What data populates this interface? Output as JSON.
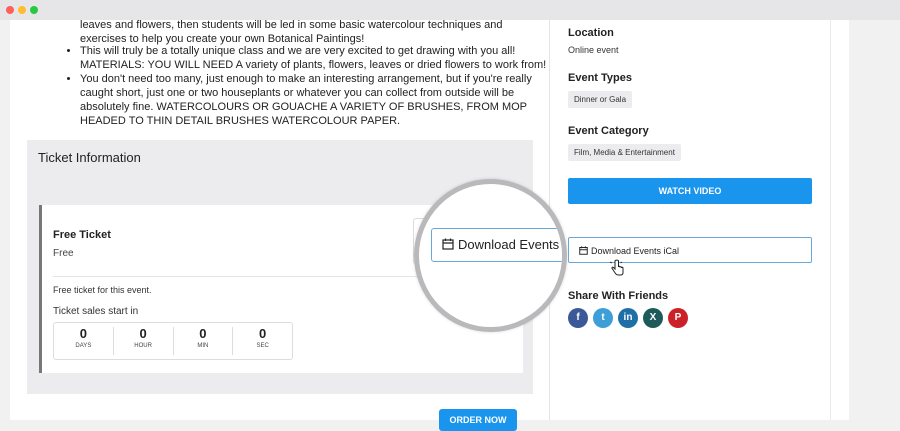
{
  "description": {
    "lead": "leaves and flowers, then students will be led in some basic watercolour techniques and exercises to help you create your own Botanical Paintings!",
    "bullets": [
      "This will truly be a totally unique class and we are very excited to get drawing with you all!   MATERIALS: YOU WILL NEED A variety of plants, flowers, leaves or dried flowers to work from!",
      "You don't need too many, just enough to make an interesting arrangement, but if you're really caught short, just one or two houseplants or whatever you can collect from outside will be absolutely fine. WATERCOLOURS OR GOUACHE A VARIETY OF BRUSHES, FROM MOP HEADED TO THIN DETAIL BRUSHES WATERCOLOUR PAPER."
    ]
  },
  "ticket": {
    "section_title": "Ticket Information",
    "name": "Free Ticket",
    "price": "Free",
    "note": "Free ticket for this event.",
    "sales_label": "Ticket sales start in",
    "countdown": [
      {
        "value": "0",
        "label": "DAYS"
      },
      {
        "value": "0",
        "label": "HOUR"
      },
      {
        "value": "0",
        "label": "MIN"
      },
      {
        "value": "0",
        "label": "SEC"
      }
    ],
    "order_label": "ORDER NOW"
  },
  "magnifier": {
    "button_label": "Download Events iCal"
  },
  "sidebar": {
    "location_title": "Location",
    "location_value": "Online event",
    "types_title": "Event Types",
    "types_tag": "Dinner or Gala",
    "category_title": "Event Category",
    "category_tag": "Film, Media & Entertainment",
    "watch_label": "WATCH VIDEO",
    "ical_label": "Download Events iCal",
    "share_title": "Share With Friends",
    "share": [
      {
        "icon": "facebook-icon",
        "glyph": "f"
      },
      {
        "icon": "twitter-icon",
        "glyph": "t"
      },
      {
        "icon": "linkedin-icon",
        "glyph": "in"
      },
      {
        "icon": "xing-icon",
        "glyph": "X"
      },
      {
        "icon": "pinterest-icon",
        "glyph": "P"
      }
    ]
  },
  "colors": {
    "accent": "#1a95ee",
    "facebook": "#3b5998",
    "twitter": "#3e9fd8",
    "linkedin": "#1f6fa7",
    "xing": "#1d5b5b",
    "pinterest": "#cb2027"
  }
}
